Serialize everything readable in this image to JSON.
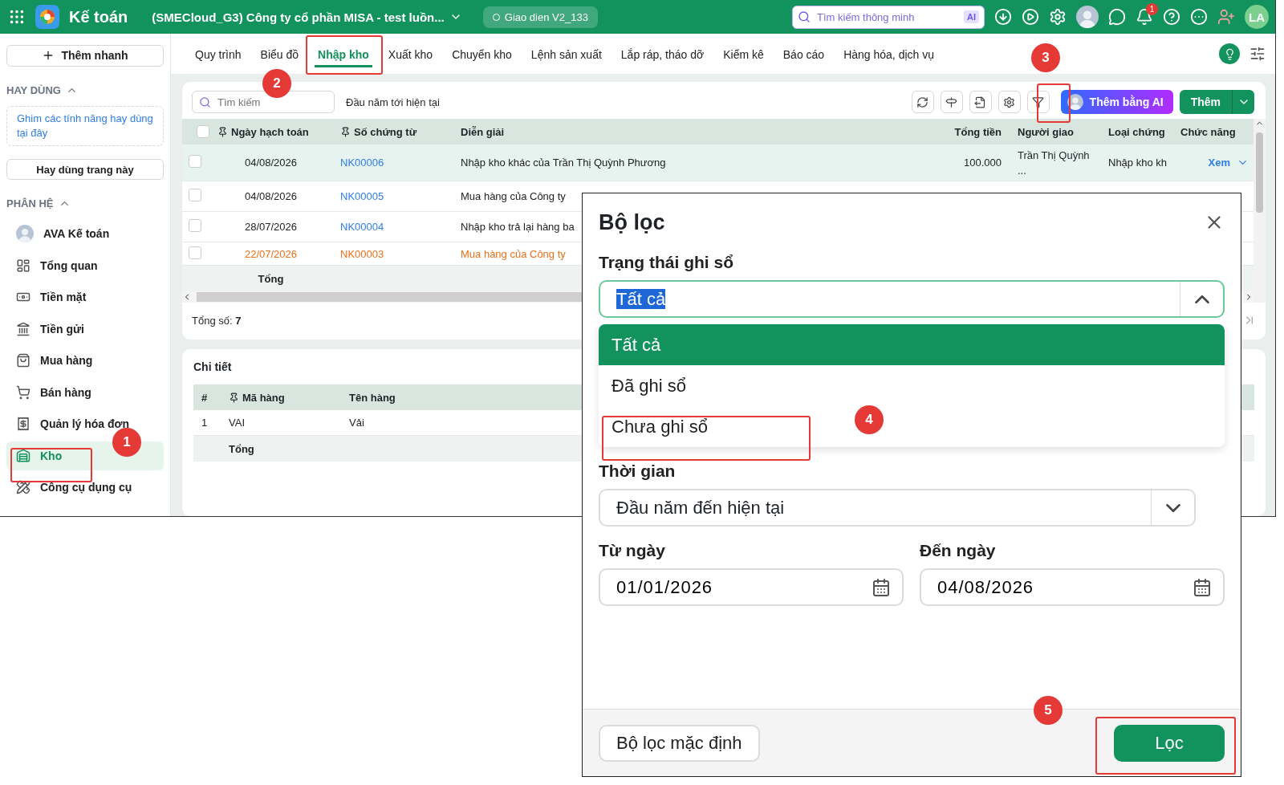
{
  "top_bar": {
    "app_name": "Kế toán",
    "company": "(SMECloud_G3) Công ty cổ phần MISA - test luồn...",
    "theme_badge": "Giao dien V2_133",
    "search": {
      "placeholder": "Tìm kiếm thông minh",
      "badge": "AI"
    },
    "notification_count": "1",
    "user_initials": "LA"
  },
  "sidebar": {
    "quick_add": "Thêm nhanh",
    "favorites": {
      "title": "HAY DÙNG",
      "expanded": true,
      "hint": "Ghim các tính năng hay dùng tại đây",
      "button": "Hay dùng trang này"
    },
    "modules": {
      "title": "PHÂN HỆ",
      "expanded": true,
      "items": [
        {
          "label": "AVA Kế toán",
          "selected": false
        },
        {
          "label": "Tổng quan",
          "selected": false
        },
        {
          "label": "Tiền mặt",
          "selected": false
        },
        {
          "label": "Tiền gửi",
          "selected": false
        },
        {
          "label": "Mua hàng",
          "selected": false
        },
        {
          "label": "Bán hàng",
          "selected": false
        },
        {
          "label": "Quản lý hóa đơn",
          "selected": false
        },
        {
          "label": "Kho",
          "selected": true
        },
        {
          "label": "Công cụ dụng cụ",
          "selected": false
        }
      ]
    }
  },
  "tabs": [
    {
      "label": "Quy trình",
      "selected": false
    },
    {
      "label": "Biểu đồ",
      "selected": false
    },
    {
      "label": "Nhập kho",
      "selected": true
    },
    {
      "label": "Xuất kho",
      "selected": false
    },
    {
      "label": "Chuyển kho",
      "selected": false
    },
    {
      "label": "Lệnh sản xuất",
      "selected": false
    },
    {
      "label": "Lắp ráp, tháo dỡ",
      "selected": false
    },
    {
      "label": "Kiểm kê",
      "selected": false
    },
    {
      "label": "Báo cáo",
      "selected": false
    },
    {
      "label": "Hàng hóa, dịch vụ",
      "selected": false
    }
  ],
  "toolbar": {
    "search": {
      "placeholder": "Tìm kiếm"
    },
    "period": "Đầu năm tới hiện tại",
    "ai_button": "Thêm bằng AI",
    "add_button": "Thêm"
  },
  "table": {
    "all_selected": false,
    "columns": [
      {
        "label": "Ngày hạch toán",
        "pinned": true
      },
      {
        "label": "Số chứng từ",
        "pinned": true
      },
      {
        "label": "Diễn giải",
        "pinned": false
      },
      {
        "label": "Tổng tiền",
        "pinned": false
      },
      {
        "label": "Người giao",
        "pinned": false
      },
      {
        "label": "Loại chứng",
        "pinned": false
      },
      {
        "label": "Chức năng",
        "pinned": false
      }
    ],
    "rows": [
      {
        "selected": true,
        "posted": true,
        "date": "04/08/2026",
        "number": "NK00006",
        "description": "Nhập kho khác của Trần Thị Quỳnh Phương",
        "total": "100.000",
        "deliverer": "Trần Thị Quỳnh ...",
        "type": "Nhập kho kh",
        "action": "Xem"
      },
      {
        "selected": false,
        "posted": true,
        "date": "04/08/2026",
        "number": "NK00005",
        "description": "Mua hàng của Công ty"
      },
      {
        "selected": false,
        "posted": true,
        "date": "28/07/2026",
        "number": "NK00004",
        "description": "Nhập kho trả lại hàng ba"
      },
      {
        "selected": false,
        "posted": false,
        "date": "22/07/2026",
        "number": "NK00003",
        "description": "Mua hàng của Công ty"
      }
    ],
    "footer": "Tổng",
    "count_label": "Tổng số:",
    "count": "7"
  },
  "detail": {
    "title": "Chi tiết",
    "columns": [
      {
        "label": "#",
        "pinned": false
      },
      {
        "label": "Mã hàng",
        "pinned": true
      },
      {
        "label": "Tên hàng",
        "pinned": false
      }
    ],
    "rows": [
      {
        "index": "1",
        "code": "VAI",
        "name": "Vải"
      }
    ],
    "footer": "Tổng"
  },
  "filter_dialog": {
    "title": "Bộ lọc",
    "status": {
      "label": "Trạng thái ghi sổ",
      "value": "Tất cả",
      "text_selected": true,
      "expanded": true,
      "options": [
        {
          "label": "Tất cả",
          "selected": true
        },
        {
          "label": "Đã ghi sổ",
          "selected": false
        },
        {
          "label": "Chưa ghi sổ",
          "selected": false
        }
      ]
    },
    "period": {
      "label": "Thời gian",
      "value": "Đầu năm đến hiện tại"
    },
    "from": {
      "label": "Từ ngày",
      "value": "01/01/2026"
    },
    "to": {
      "label": "Đến ngày",
      "value": "04/08/2026"
    },
    "default_button": "Bộ lọc mặc định",
    "apply_button": "Lọc"
  },
  "annotations": [
    {
      "label": "1"
    },
    {
      "label": "2"
    },
    {
      "label": "3"
    },
    {
      "label": "4"
    },
    {
      "label": "5"
    }
  ]
}
